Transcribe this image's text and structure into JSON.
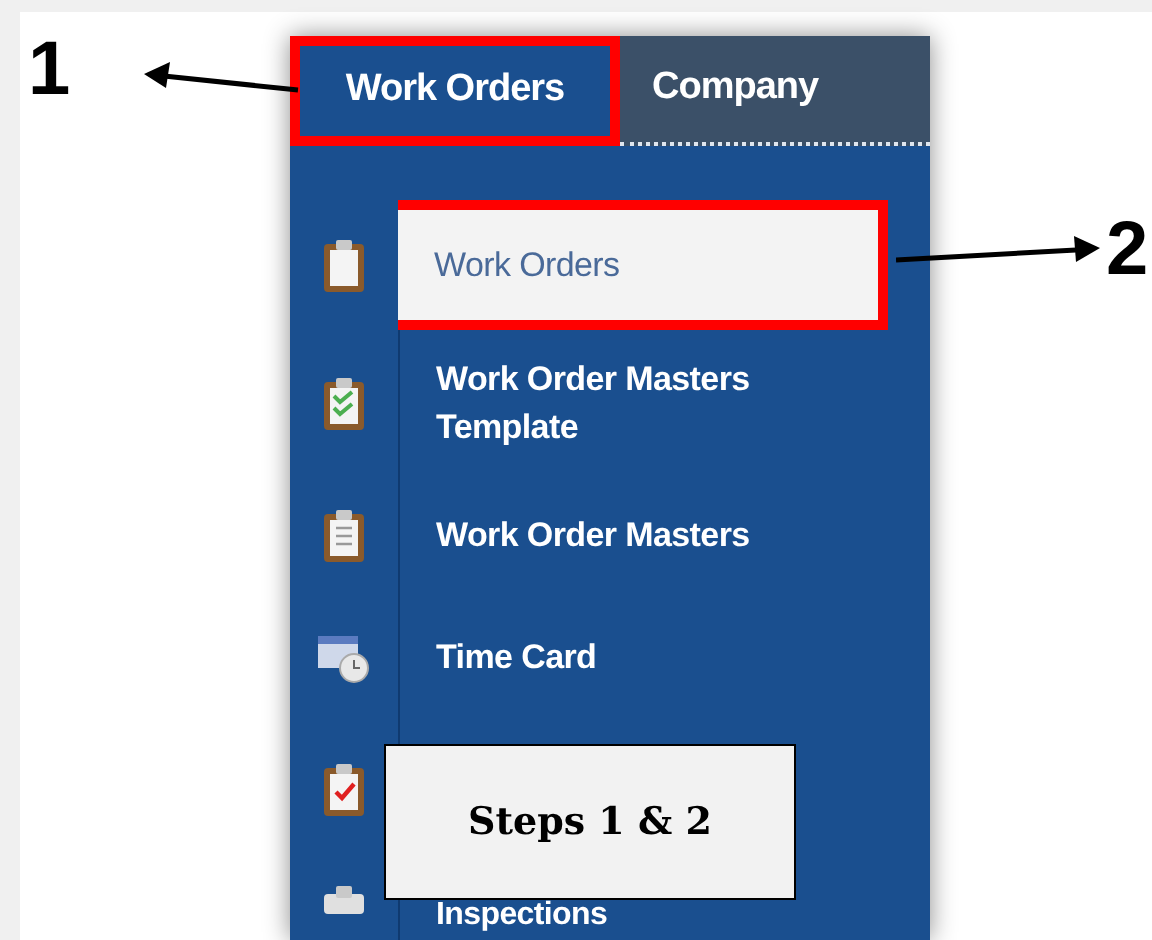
{
  "annotations": [
    {
      "number": "1"
    },
    {
      "number": "2"
    }
  ],
  "tabs": [
    {
      "label": "Work Orders",
      "selected": true
    },
    {
      "label": "Company",
      "selected": false
    }
  ],
  "menu": [
    {
      "kind": "item",
      "label": "Work Orders",
      "selected": true
    },
    {
      "kind": "item",
      "label": "Work Order Masters Template",
      "selected": false
    },
    {
      "kind": "item",
      "label": "Work Order Masters",
      "selected": false
    },
    {
      "kind": "item",
      "label": "Time Card",
      "selected": false
    },
    {
      "kind": "covered"
    },
    {
      "kind": "item",
      "label": "Inspections",
      "selected": false
    }
  ],
  "callout": {
    "text": "Steps 1 & 2"
  }
}
